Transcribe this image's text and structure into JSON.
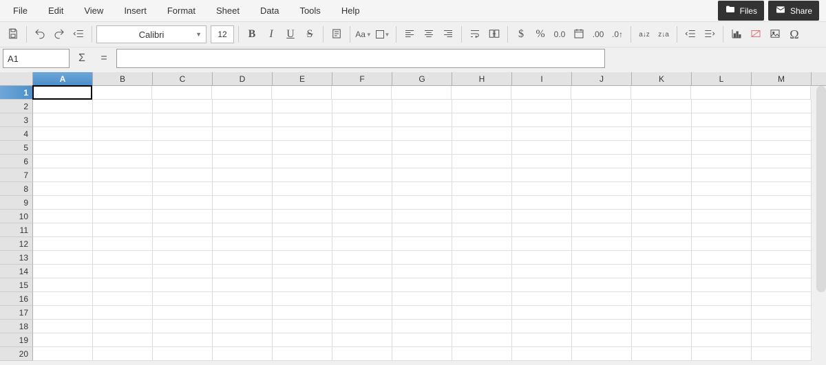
{
  "menu": {
    "items": [
      "File",
      "Edit",
      "View",
      "Insert",
      "Format",
      "Sheet",
      "Data",
      "Tools",
      "Help"
    ]
  },
  "header_buttons": {
    "files": "Files",
    "share": "Share"
  },
  "toolbar": {
    "font_name": "Calibri",
    "font_size": "12",
    "bold": "B",
    "italic": "I",
    "underline": "U",
    "strike": "S",
    "case": "Aa",
    "currency": "$",
    "percent": "%",
    "decimal": "0.0",
    "decimal00": ".00",
    "dec_inc": ".0↑",
    "sort_asc": "a↓z",
    "sort_desc": "z↓a",
    "omega": "Ω"
  },
  "refbar": {
    "cell_ref": "A1",
    "sigma": "Σ",
    "equals": "=",
    "formula_value": ""
  },
  "grid": {
    "columns": [
      "A",
      "B",
      "C",
      "D",
      "E",
      "F",
      "G",
      "H",
      "I",
      "J",
      "K",
      "L",
      "M"
    ],
    "rows": [
      "1",
      "2",
      "3",
      "4",
      "5",
      "6",
      "7",
      "8",
      "9",
      "10",
      "11",
      "12",
      "13",
      "14",
      "15",
      "16",
      "17",
      "18",
      "19",
      "20"
    ],
    "selected_col": "A",
    "selected_row": "1"
  }
}
